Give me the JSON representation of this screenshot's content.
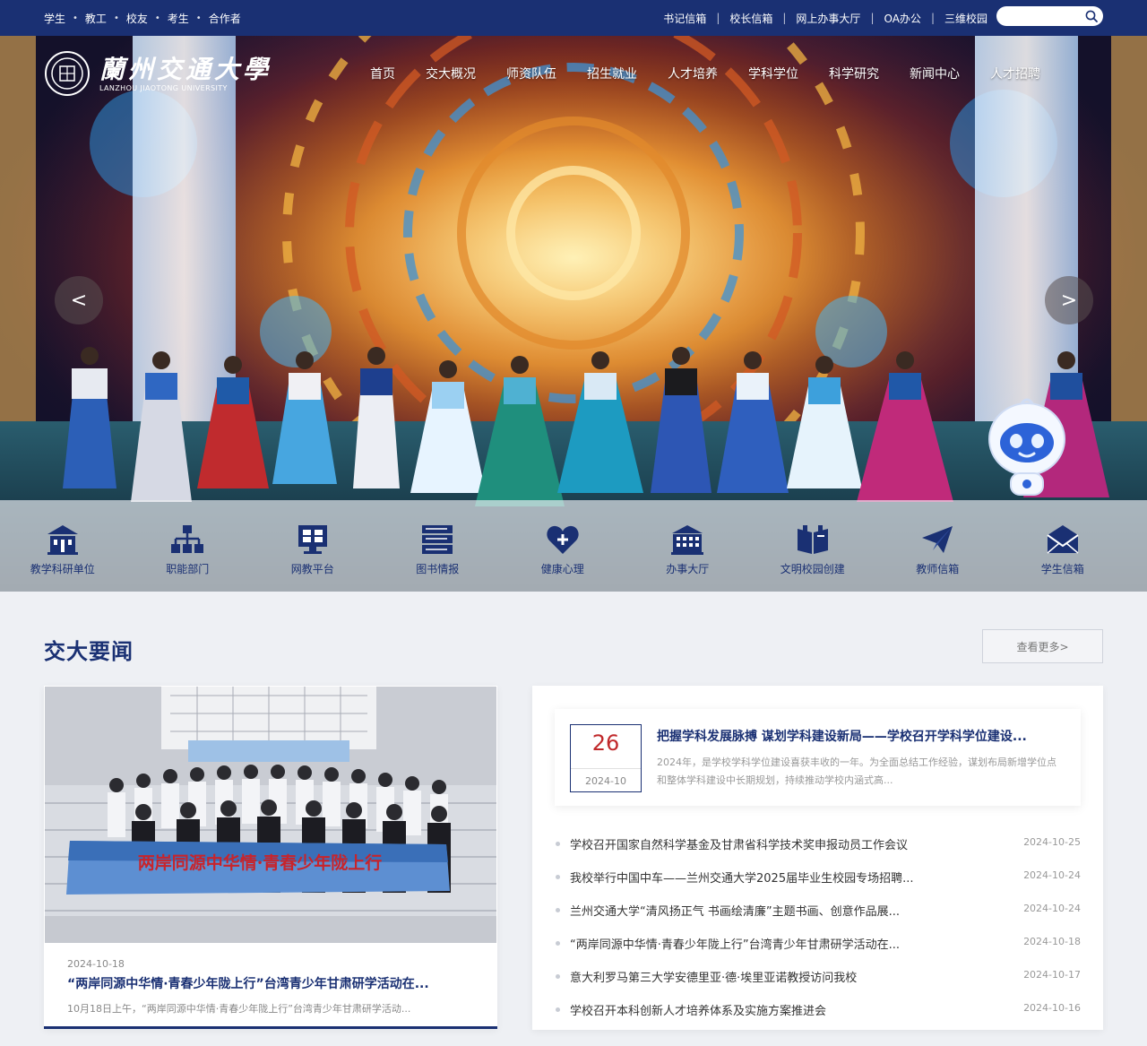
{
  "topbar": {
    "audience": [
      "学生",
      "教工",
      "校友",
      "考生",
      "合作者"
    ],
    "links": [
      "书记信箱",
      "校长信箱",
      "网上办事大厅",
      "OA办公",
      "三维校园"
    ],
    "search_placeholder": ""
  },
  "logo": {
    "cn": "蘭州交通大學",
    "en": "LANZHOU JIAOTONG UNIVERSITY"
  },
  "nav": [
    "首页",
    "交大概况",
    "师资队伍",
    "招生就业",
    "人才培养",
    "学科学位",
    "科学研究",
    "新闻中心",
    "人才招聘"
  ],
  "carousel": {
    "prev": "<",
    "next": ">"
  },
  "quicklinks": [
    {
      "label": "教学科研单位",
      "icon": "building-icon"
    },
    {
      "label": "职能部门",
      "icon": "org-chart-icon"
    },
    {
      "label": "网教平台",
      "icon": "monitor-icon"
    },
    {
      "label": "图书情报",
      "icon": "books-icon"
    },
    {
      "label": "健康心理",
      "icon": "heart-plus-icon"
    },
    {
      "label": "办事大厅",
      "icon": "hall-icon"
    },
    {
      "label": "文明校园创建",
      "icon": "campus-book-icon"
    },
    {
      "label": "教师信箱",
      "icon": "paper-plane-icon"
    },
    {
      "label": "学生信箱",
      "icon": "envelope-icon"
    }
  ],
  "news": {
    "title": "交大要闻",
    "more": "查看更多>",
    "feature": {
      "date": "2024-10-18",
      "title": "“两岸同源中华情·青春少年陇上行”台湾青少年甘肃研学活动在...",
      "desc": "10月18日上午，“两岸同源中华情·青春少年陇上行”台湾青少年甘肃研学活动...",
      "banner": "两岸同源中华情·青春少年陇上行"
    },
    "top": {
      "day": "26",
      "ym": "2024-10",
      "title": "把握学科发展脉搏 谋划学科建设新局——学校召开学科学位建设...",
      "desc": "2024年，是学校学科学位建设喜获丰收的一年。为全面总结工作经验，谋划布局新增学位点和整体学科建设中长期规划，持续推动学校内涵式高..."
    },
    "items": [
      {
        "title": "学校召开国家自然科学基金及甘肃省科学技术奖申报动员工作会议",
        "date": "2024-10-25"
      },
      {
        "title": "我校举行中国中车——兰州交通大学2025届毕业生校园专场招聘...",
        "date": "2024-10-24"
      },
      {
        "title": "兰州交通大学“清风扬正气 书画绘清廉”主题书画、创意作品展...",
        "date": "2024-10-24"
      },
      {
        "title": "“两岸同源中华情·青春少年陇上行”台湾青少年甘肃研学活动在...",
        "date": "2024-10-18"
      },
      {
        "title": "意大利罗马第三大学安德里亚·德·埃里亚诺教授访问我校",
        "date": "2024-10-17"
      },
      {
        "title": "学校召开本科创新人才培养体系及实施方案推进会",
        "date": "2024-10-16"
      }
    ]
  }
}
